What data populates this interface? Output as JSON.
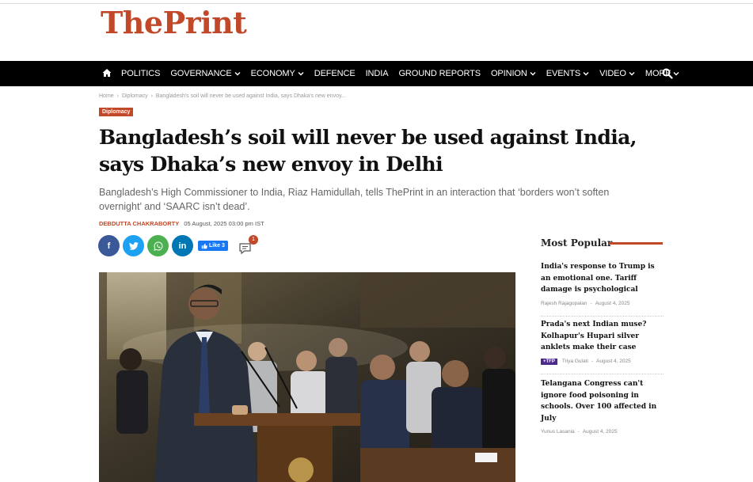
{
  "site": {
    "logo_part1": "The",
    "logo_part2": "Print"
  },
  "nav": {
    "items": [
      {
        "label": "POLITICS",
        "dropdown": false
      },
      {
        "label": "GOVERNANCE",
        "dropdown": true
      },
      {
        "label": "ECONOMY",
        "dropdown": true
      },
      {
        "label": "DEFENCE",
        "dropdown": false
      },
      {
        "label": "INDIA",
        "dropdown": false
      },
      {
        "label": "GROUND REPORTS",
        "dropdown": false
      },
      {
        "label": "OPINION",
        "dropdown": true
      },
      {
        "label": "EVENTS",
        "dropdown": true
      },
      {
        "label": "VIDEO",
        "dropdown": true
      },
      {
        "label": "MORE",
        "dropdown": true
      }
    ],
    "home_icon": "home-icon",
    "search_icon": "search-icon"
  },
  "breadcrumb": {
    "home": "Home",
    "sep": "›",
    "section": "Diplomacy",
    "current": "Bangladesh's soil will never be used against India, says Dhaka's new envoy..."
  },
  "article": {
    "category": "Diplomacy",
    "headline": "Bangladesh’s soil will never be used against India, says Dhaka’s new envoy in Delhi",
    "dek": "Bangladesh’s High Commissioner to India, Riaz Hamidullah, tells ThePrint in an interaction that ‘borders won’t soften overnight’ and ‘SAARC isn’t dead’.",
    "author": "DEBDUTTA CHAKRABORTY",
    "date": "05 August, 2025 03:00 pm IST",
    "like_label": "Like 3",
    "comment_count": "1"
  },
  "share": {
    "facebook": "f",
    "twitter": "t",
    "whatsapp": "w",
    "linkedin": "in"
  },
  "most_popular": {
    "title": "Most Popular",
    "items": [
      {
        "title": "India's response to Trump is an emotional one. Tariff damage is psychological",
        "author": "Rajesh Rajagopalan",
        "date": "August 4, 2025",
        "tag": ""
      },
      {
        "title": "Prada's next Indian muse? Kolhapur's Hupari silver anklets make their case",
        "author": "Triya Gulati",
        "date": "August 4, 2025",
        "tag": "+TFP"
      },
      {
        "title": "Telangana Congress can't ignore food poisoning in schools. Over 100 affected in July",
        "author": "Yunus Lasania",
        "date": "August 4, 2025",
        "tag": ""
      }
    ]
  },
  "colors": {
    "brand": "#c1492a",
    "nav_bg": "#000000",
    "tfp_tag": "#4b2a8a"
  }
}
